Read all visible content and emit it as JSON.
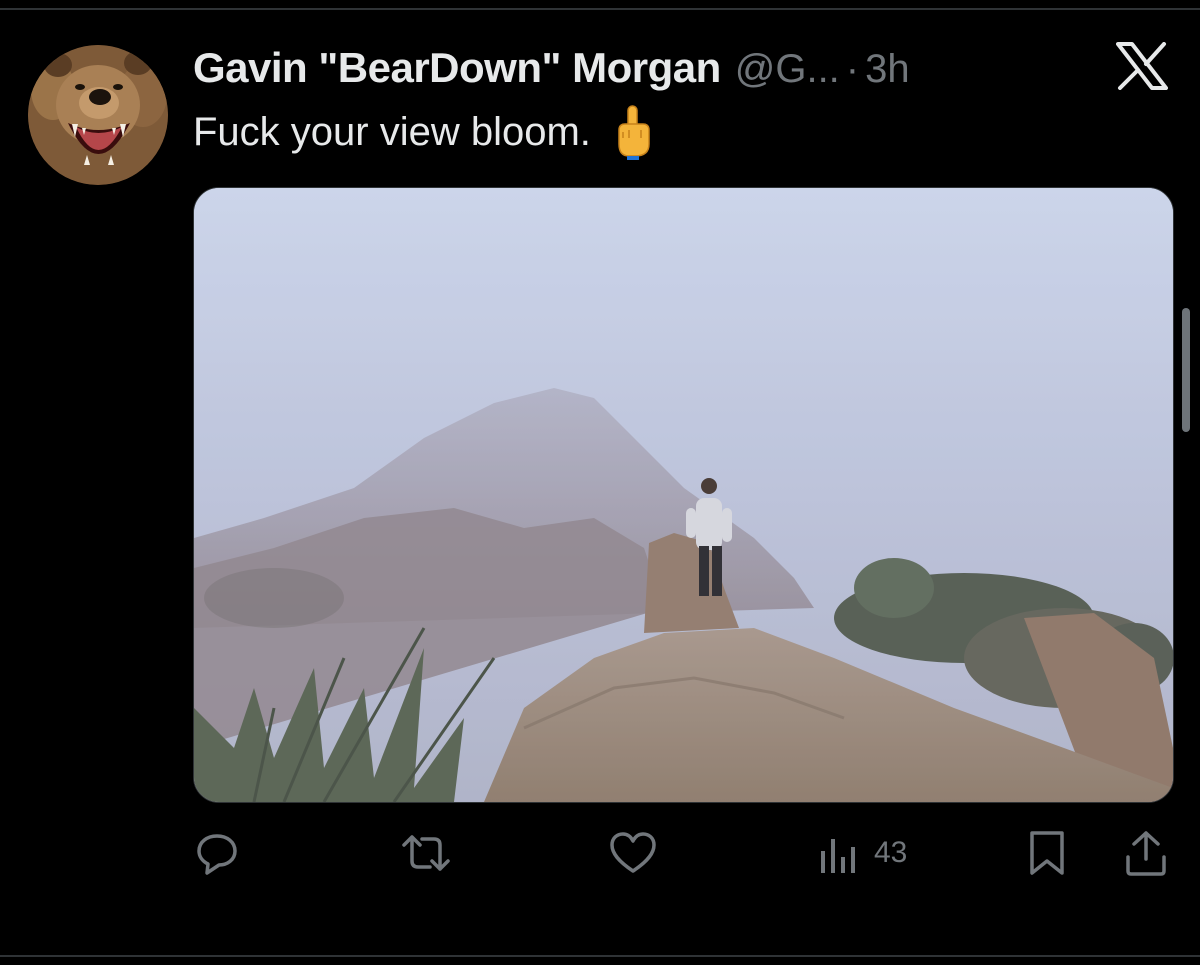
{
  "tweet": {
    "author_name": "Gavin \"BearDown\" Morgan",
    "handle": "@G...",
    "separator": "·",
    "time": "3h",
    "text": "Fuck your view bloom.",
    "emoji": "middle-finger-emoji",
    "media_alt_icon": "photo"
  },
  "actions": {
    "reply_icon": "reply-icon",
    "retweet_icon": "retweet-icon",
    "like_icon": "heart-icon",
    "views_icon": "views-icon",
    "views_count": "43",
    "bookmark_icon": "bookmark-icon",
    "share_icon": "share-icon"
  },
  "colors": {
    "background": "#000000",
    "primary_text": "#e7e9ea",
    "secondary_text": "#71767b",
    "border": "#2f3336"
  }
}
